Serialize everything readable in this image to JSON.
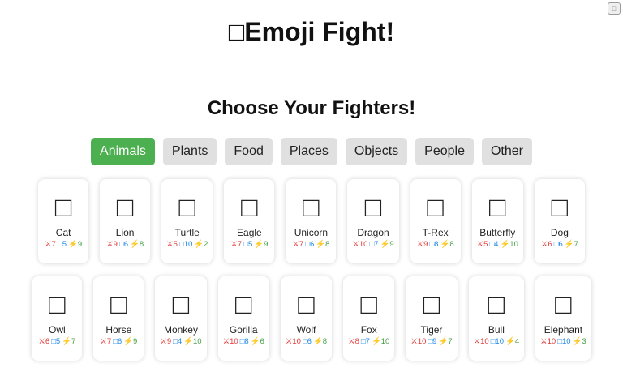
{
  "header": {
    "title": "□Emoji Fight!",
    "settings_icon": "□"
  },
  "picker": {
    "heading": "Choose Your Fighters!",
    "tabs": [
      "Animals",
      "Plants",
      "Food",
      "Places",
      "Objects",
      "People",
      "Other"
    ],
    "active_tab": "Animals"
  },
  "colors": {
    "active_tab": "#4caf50",
    "inactive_tab": "#e0e0e0",
    "attack": "#e53935",
    "defense": "#1e88e5",
    "speed": "#43a047"
  },
  "fighters": [
    {
      "name": "Cat",
      "emoji": "□",
      "atk": "⚔︎7",
      "def": "□5",
      "spd": "⚡9"
    },
    {
      "name": "Lion",
      "emoji": "□",
      "atk": "⚔︎9",
      "def": "□6",
      "spd": "⚡8"
    },
    {
      "name": "Turtle",
      "emoji": "□",
      "atk": "⚔︎5",
      "def": "□10",
      "spd": "⚡2"
    },
    {
      "name": "Eagle",
      "emoji": "□",
      "atk": "⚔︎7",
      "def": "□5",
      "spd": "⚡9"
    },
    {
      "name": "Unicorn",
      "emoji": "□",
      "atk": "⚔︎7",
      "def": "□6",
      "spd": "⚡8"
    },
    {
      "name": "Dragon",
      "emoji": "□",
      "atk": "⚔︎10",
      "def": "□7",
      "spd": "⚡9"
    },
    {
      "name": "T-Rex",
      "emoji": "□",
      "atk": "⚔︎9",
      "def": "□8",
      "spd": "⚡8"
    },
    {
      "name": "Butterfly",
      "emoji": "□",
      "atk": "⚔︎5",
      "def": "□4",
      "spd": "⚡10"
    },
    {
      "name": "Dog",
      "emoji": "□",
      "atk": "⚔︎6",
      "def": "□6",
      "spd": "⚡7"
    },
    {
      "name": "Owl",
      "emoji": "□",
      "atk": "⚔︎6",
      "def": "□5",
      "spd": "⚡7"
    },
    {
      "name": "Horse",
      "emoji": "□",
      "atk": "⚔︎7",
      "def": "□6",
      "spd": "⚡9"
    },
    {
      "name": "Monkey",
      "emoji": "□",
      "atk": "⚔︎9",
      "def": "□4",
      "spd": "⚡10"
    },
    {
      "name": "Gorilla",
      "emoji": "□",
      "atk": "⚔︎10",
      "def": "□8",
      "spd": "⚡6"
    },
    {
      "name": "Wolf",
      "emoji": "□",
      "atk": "⚔︎10",
      "def": "□6",
      "spd": "⚡8"
    },
    {
      "name": "Fox",
      "emoji": "□",
      "atk": "⚔︎8",
      "def": "□7",
      "spd": "⚡10"
    },
    {
      "name": "Tiger",
      "emoji": "□",
      "atk": "⚔︎10",
      "def": "□9",
      "spd": "⚡7"
    },
    {
      "name": "Bull",
      "emoji": "□",
      "atk": "⚔︎10",
      "def": "□10",
      "spd": "⚡4"
    },
    {
      "name": "Elephant",
      "emoji": "□",
      "atk": "⚔︎10",
      "def": "□10",
      "spd": "⚡3"
    }
  ]
}
